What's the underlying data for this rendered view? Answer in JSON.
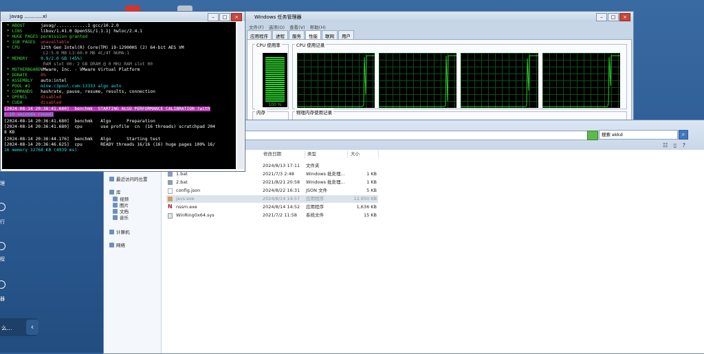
{
  "terminal": {
    "title": "javag ............xl",
    "lines": [
      {
        "k": " * ABOUT",
        "v": "javag/............1 gcc/10.2.0"
      },
      {
        "k": " * LIBS",
        "v": "libuv/1.41.0 OpenSSL/1.1.1j hwloc/2.4.1"
      },
      {
        "k": " * HUGE PAGES",
        "v": "permission granted"
      },
      {
        "k": " * 1GB PAGES",
        "v": "unavailable"
      },
      {
        "k": " * CPU",
        "v": "12th Gen Intel(R) Core(TM) i9-12900HS (2) 64-bit AES VM"
      },
      {
        "k": "",
        "v": "L2:5.0 MB L3:60.0 MB 4C/4T NUMA:1"
      },
      {
        "k": " * MEMORY",
        "v": "0.9/2.0 GB (45%)"
      },
      {
        "k": "",
        "v": "RAM slot 00: 2 GB DRAM @ 0 MHz RAM slot 00"
      },
      {
        "k": " * MOTHERBOARD",
        "v": "VMware, Inc. - VMware Virtual Platform"
      },
      {
        "k": " * DONATE",
        "v": "0%"
      },
      {
        "k": " * ASSEMBLY",
        "v": "auto:intel"
      },
      {
        "k": " * POOL #1",
        "v": "mine.c3pool.com:13333 algo auto"
      },
      {
        "k": " * COMMANDS",
        "v": "hashrate, pause, resume, results, connection"
      },
      {
        "k": " * OPENCL",
        "v": "disabled"
      },
      {
        "k": " * CUDA",
        "v": "disabled"
      }
    ],
    "log": [
      "[2024-08-14 20:36:41.680]  benchmk  STARTING ALGO PERFORMANCE CALIBRATION (with",
      "n 10 seconds round)",
      "[2024-08-14 20:36:41.680]  benchmk   Algo      Preparation",
      "[2024-08-14 20:36:41.680]  cpu       use profile  cn  (16 threads) scratchpad 204",
      "8 KB",
      "[2024-08-14 20:36:44.176]  benchmk   Algo      Starting test",
      "[2024-08-14 20:36:46.625]  cpu       READY threads 16/16 (16) huge pages 100% 16/",
      "16 memory 32768 KB (4939 ms)"
    ]
  },
  "task_manager": {
    "title": "Windows 任务管理器",
    "menu": [
      "文件(F)",
      "选项(O)",
      "查看(V)",
      "帮助(H)"
    ],
    "tabs": [
      "应用程序",
      "进程",
      "服务",
      "性能",
      "联网",
      "用户"
    ],
    "active_tab": "性能",
    "cpu_usage_label": "CPU 使用率",
    "cpu_history_label": "CPU 使用记录",
    "cpu_percent": "100 %",
    "memory_label": "内存",
    "memory_history_label": "物理内存使用记录"
  },
  "explorer": {
    "search_placeholder": "搜索 ekkd",
    "columns": [
      "修改日期",
      "类型",
      "大小"
    ],
    "nav": [
      {
        "label": "最近访问的位置"
      },
      {
        "label": "库"
      },
      {
        "label": "视频"
      },
      {
        "label": "图片"
      },
      {
        "label": "文档"
      },
      {
        "label": "音乐"
      },
      {
        "label": "计算机"
      },
      {
        "label": "网络"
      }
    ],
    "files": [
      {
        "name": "",
        "date": "2024/8/13 17:11",
        "type": "文件夹",
        "size": ""
      },
      {
        "name": "1.bat",
        "date": "2021/7/3 2:48",
        "type": "Windows 批处理...",
        "size": "1 KB"
      },
      {
        "name": "2.bat",
        "date": "2021/8/21 20:58",
        "type": "Windows 批处理...",
        "size": "1 KB"
      },
      {
        "name": "config.json",
        "date": "2024/8/22 16:31",
        "type": "JSON 文件",
        "size": "5 KB"
      },
      {
        "name": "javs.exe",
        "date": "2024/8/14 14:57",
        "type": "应用程序",
        "size": "12,950 KB"
      },
      {
        "name": "nssm.exe",
        "date": "2024/8/14 14:52",
        "type": "应用程序",
        "size": "1,636 KB"
      },
      {
        "name": "WinRing0x64.sys",
        "date": "2021/7/2 11:58",
        "type": "系统文件",
        "size": "15 KB"
      }
    ]
  },
  "desktop": {
    "side_labels": [
      "理",
      "行",
      "程",
      "器"
    ],
    "collapse_text": "么..."
  }
}
